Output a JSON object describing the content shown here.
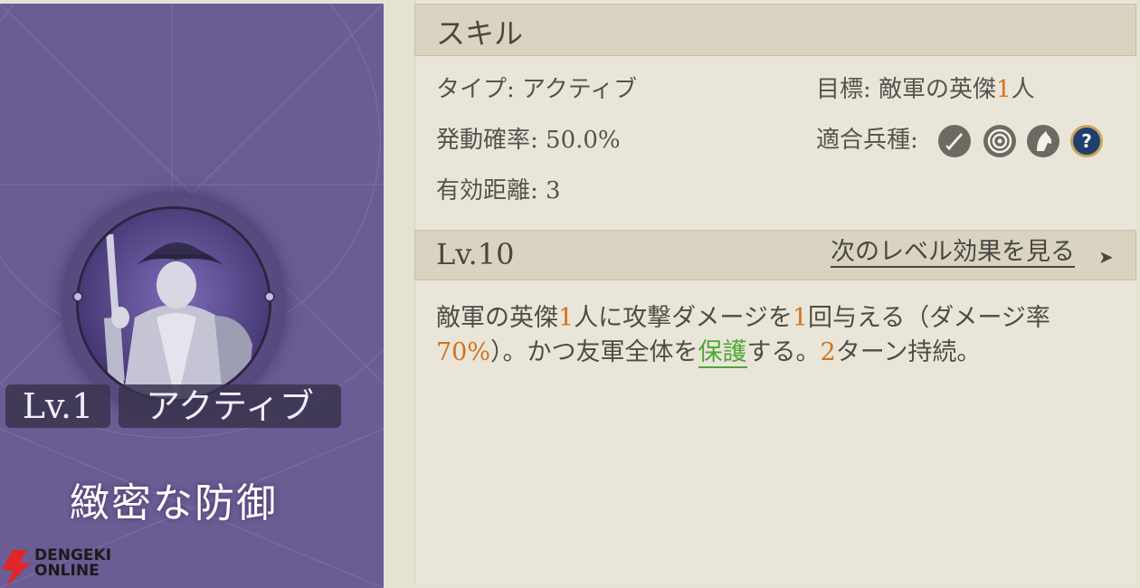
{
  "card": {
    "level": "Lv.1",
    "type": "アクティブ",
    "name": "緻密な防御"
  },
  "logo": {
    "line1": "DENGEKI",
    "line2": "ONLINE"
  },
  "skill": {
    "header": "スキル",
    "type_label": "タイプ:",
    "type_value": "アクティブ",
    "rate_label": "発動確率:",
    "rate_value": "50.0%",
    "range_label": "有効距離:",
    "range_value": "3",
    "target_label": "目標:",
    "target_prefix": "敵軍の英傑",
    "target_count": "1",
    "target_suffix": "人",
    "units_label": "適合兵種:",
    "unit_icons": [
      "sword-icon",
      "target-icon",
      "horse-icon",
      "question-icon"
    ]
  },
  "level": {
    "title": "Lv.10",
    "next_link": "次のレベル効果を見る"
  },
  "description": {
    "p1": "敵軍の英傑",
    "n1": "1",
    "p2": "人に攻撃ダメージを",
    "n2": "1",
    "p3": "回与える（ダメージ率",
    "n3": "70%",
    "p4": "）。かつ友軍全体を",
    "link": "保護",
    "p5": "する。",
    "n4": "2",
    "p6": "ターン持続。"
  },
  "colors": {
    "card_purple": "#6b5c94",
    "highlight_orange": "#d6711b",
    "link_green": "#4fa63a",
    "panel_bg": "#e9e6d9"
  }
}
